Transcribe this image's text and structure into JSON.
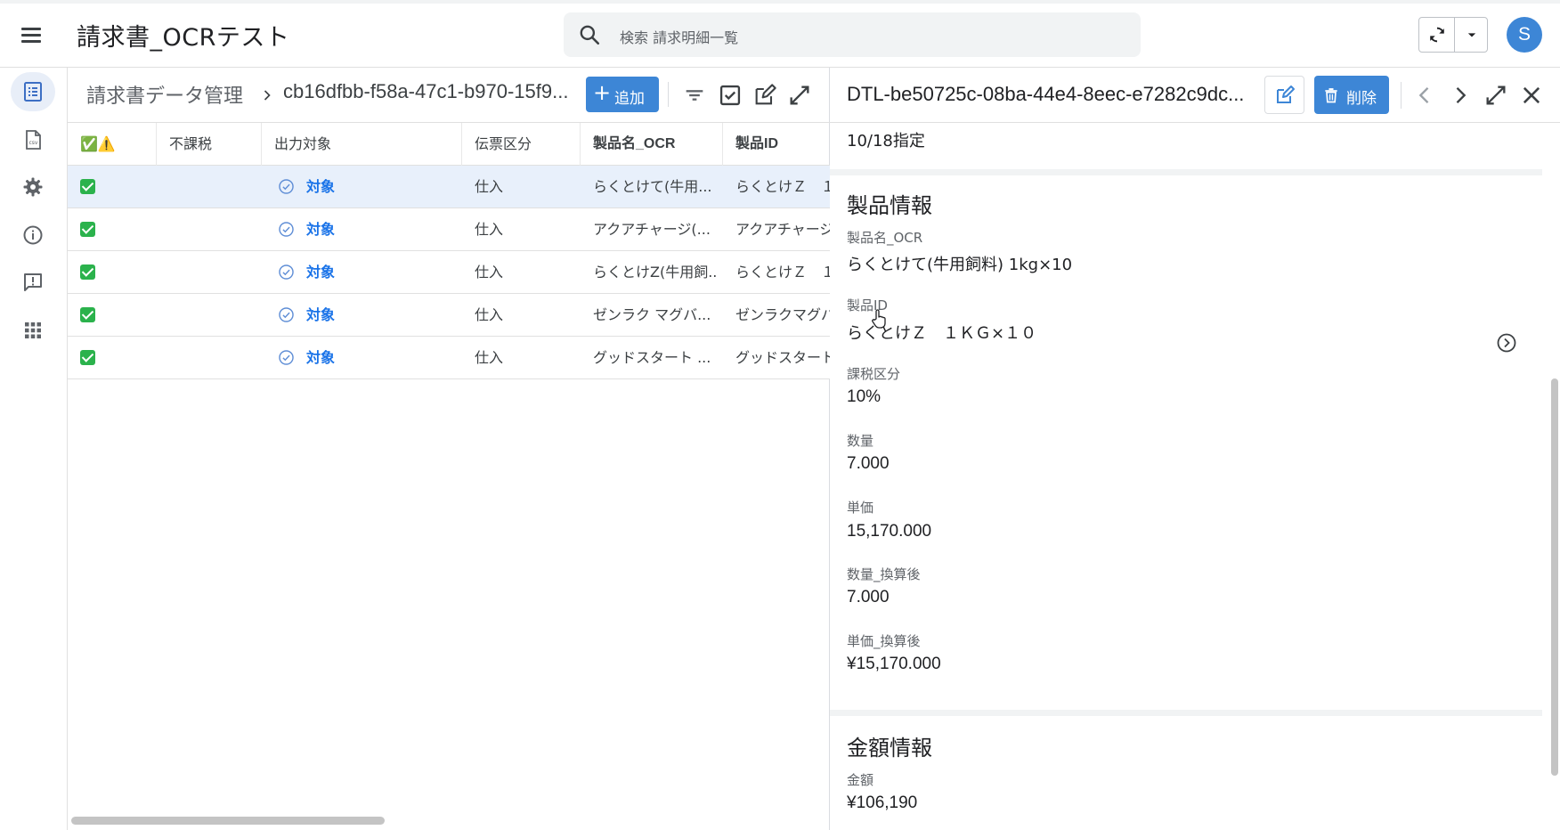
{
  "app": {
    "title": "請求書_OCRテスト",
    "search_placeholder": "検索 請求明細一覧",
    "avatar_initial": "S",
    "accent_color": "#3d86d6"
  },
  "rail": {
    "items": [
      {
        "icon": "list-icon",
        "active": true
      },
      {
        "icon": "csv-file-icon",
        "active": false
      },
      {
        "icon": "gear-icon",
        "active": false
      },
      {
        "icon": "info-icon",
        "active": false
      },
      {
        "icon": "feedback-icon",
        "active": false
      },
      {
        "icon": "apps-grid-icon",
        "active": false
      }
    ]
  },
  "list": {
    "breadcrumb_root": "請求書データ管理",
    "breadcrumb_id": "cb16dfbb-f58a-47c1-b970-15f9...",
    "add_label": "追加",
    "columns": [
      "✅⚠️",
      "不課税",
      "出力対象",
      "伝票区分",
      "製品名_OCR",
      "製品ID"
    ],
    "rows": [
      {
        "target": "対象",
        "slip": "仕入",
        "product_ocr": "らくとけて(牛用...",
        "product_id": "らくとけＺ　１"
      },
      {
        "target": "対象",
        "slip": "仕入",
        "product_ocr": "アクアチャージ(...",
        "product_id": "アクアチャージ"
      },
      {
        "target": "対象",
        "slip": "仕入",
        "product_ocr": "らくとけZ(牛用飼...",
        "product_id": "らくとけＺ　１"
      },
      {
        "target": "対象",
        "slip": "仕入",
        "product_ocr": "ゼンラク マグバ...",
        "product_id": "ゼンラクマグバ"
      },
      {
        "target": "対象",
        "slip": "仕入",
        "product_ocr": "グッドスタート ...",
        "product_id": "グッドスタート"
      }
    ]
  },
  "detail": {
    "title": "DTL-be50725c-08ba-44e4-8eec-e7282c9dc...",
    "delete_label": "削除",
    "first_line": "10/18指定",
    "product_section": {
      "title": "製品情報",
      "fields": [
        {
          "label": "製品名_OCR",
          "value": "らくとけて(牛用飼料) 1kg×10"
        },
        {
          "label": "製品ID",
          "value": "らくとけＺ　１ＫＧ×１０"
        },
        {
          "label": "課税区分",
          "value": "10%"
        },
        {
          "label": "数量",
          "value": "7.000"
        },
        {
          "label": "単価",
          "value": "15,170.000"
        },
        {
          "label": "数量_換算後",
          "value": "7.000"
        },
        {
          "label": "単価_換算後",
          "value": "¥15,170.000"
        }
      ]
    },
    "amount_section": {
      "title": "金額情報",
      "fields": [
        {
          "label": "金額",
          "value": "¥106,190"
        }
      ]
    }
  }
}
